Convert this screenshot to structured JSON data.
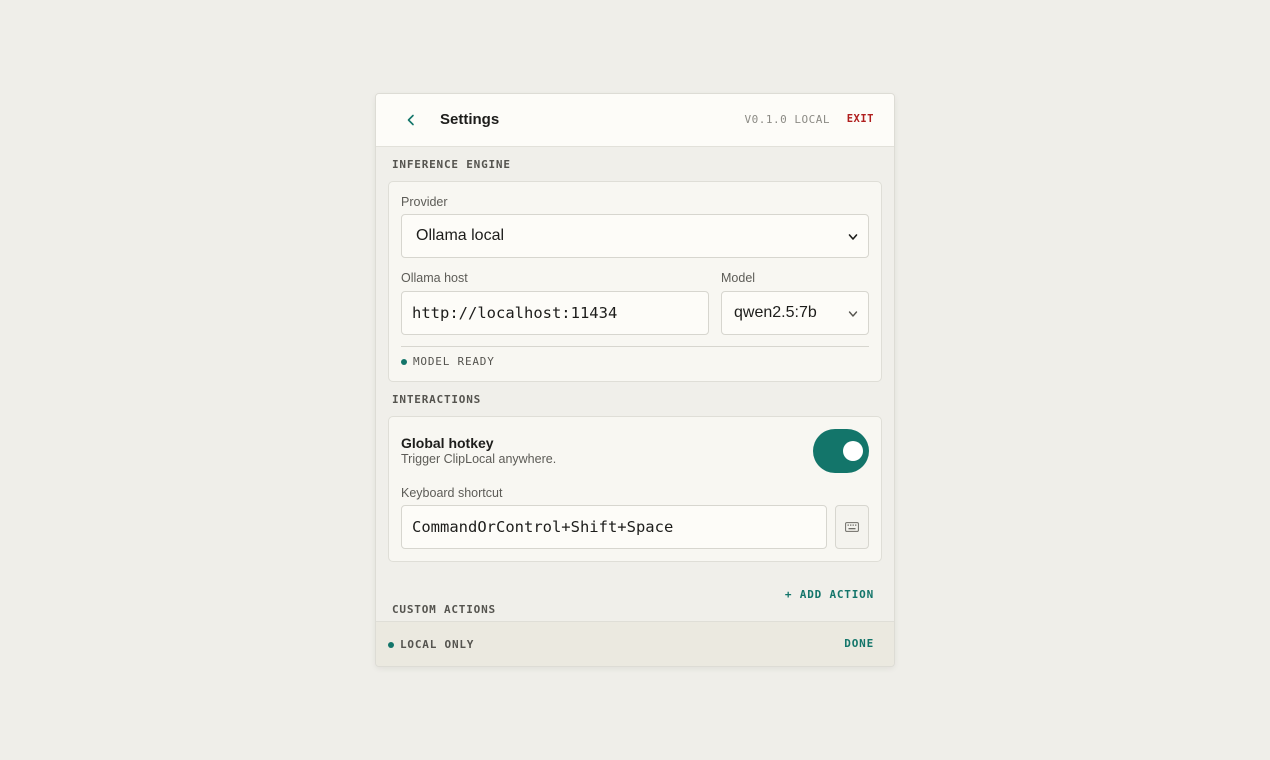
{
  "header": {
    "title": "Settings",
    "version": "V0.1.0 LOCAL",
    "exit_label": "EXIT",
    "back_icon": "chevron-left-icon"
  },
  "inference": {
    "section_label": "INFERENCE ENGINE",
    "provider_label": "Provider",
    "provider_value": "Ollama local",
    "host_label": "Ollama host",
    "host_value": "http://localhost:11434",
    "model_label": "Model",
    "model_value": "qwen2.5:7b",
    "status": "MODEL READY",
    "status_color": "#13756a"
  },
  "interactions": {
    "section_label": "INTERACTIONS",
    "hotkey_title": "Global hotkey",
    "hotkey_desc": "Trigger ClipLocal anywhere.",
    "hotkey_enabled": true,
    "shortcut_label": "Keyboard shortcut",
    "shortcut_value": "CommandOrControl+Shift+Space",
    "shortcut_icon": "keyboard-icon"
  },
  "custom_actions": {
    "add_label": "+ ADD ACTION",
    "section_label": "CUSTOM ACTIONS"
  },
  "footer": {
    "status": "LOCAL ONLY",
    "done_label": "DONE"
  },
  "colors": {
    "accent": "#13756a",
    "danger": "#b01e1e",
    "background": "#efeee9"
  }
}
